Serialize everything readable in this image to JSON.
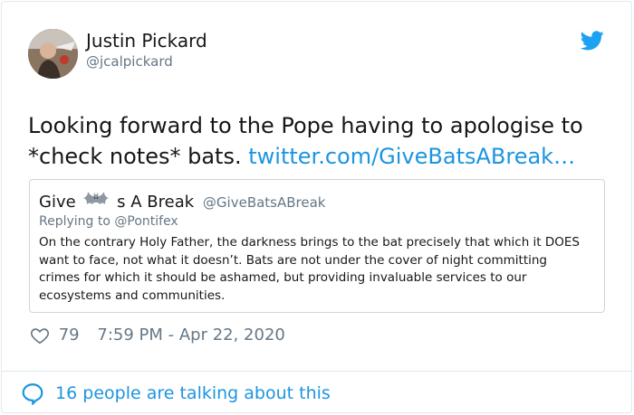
{
  "author": {
    "name": "Justin Pickard",
    "handle": "@jcalpickard",
    "avatar_icon": "user-avatar-photo"
  },
  "tweet": {
    "text_main": "Looking forward to the Pope having to apologise to *check notes* bats.",
    "link_text": "twitter.com/GiveBatsABreak…"
  },
  "quoted": {
    "name_before": "Give",
    "name_icon": "bat-emoji-icon",
    "name_after": "s A Break",
    "handle": "@GiveBatsABreak",
    "reply_to": "Replying to @Pontifex",
    "text": "On the contrary Holy Father, the darkness brings to the bat precisely that which it DOES want to face, not what it doesn’t. Bats are not under the cover of night committing crimes for which it should be ashamed, but providing invaluable services to our ecosystems and communities."
  },
  "meta": {
    "likes": "79",
    "timestamp": "7:59 PM - Apr 22, 2020"
  },
  "footer": {
    "conversation_text": "16 people are talking about this"
  },
  "colors": {
    "link": "#1b95e0",
    "muted": "#657786",
    "border": "#e1e8ed"
  }
}
